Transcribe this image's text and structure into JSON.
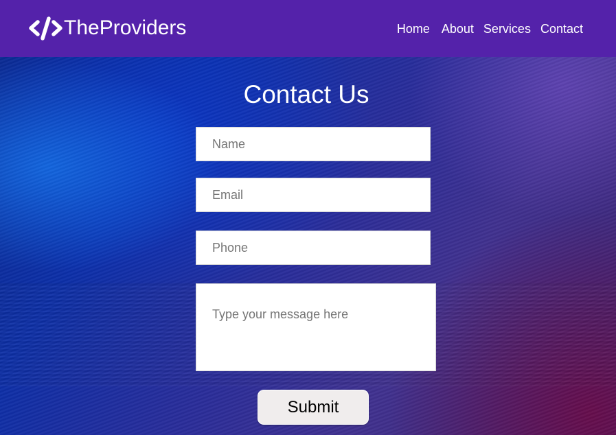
{
  "nav": {
    "logo_text": "TheProviders",
    "logo_icon": "code-brackets-icon",
    "links": [
      "Home",
      "About",
      "Services",
      "Contact"
    ]
  },
  "form": {
    "title": "Contact Us",
    "name_placeholder": "Name",
    "email_placeholder": "Email",
    "phone_placeholder": "Phone",
    "message_placeholder": "Type your message here",
    "submit_label": "Submit"
  },
  "colors": {
    "navbar": "#5422aa",
    "text": "#ffffff",
    "button_bg": "#f0eded"
  }
}
